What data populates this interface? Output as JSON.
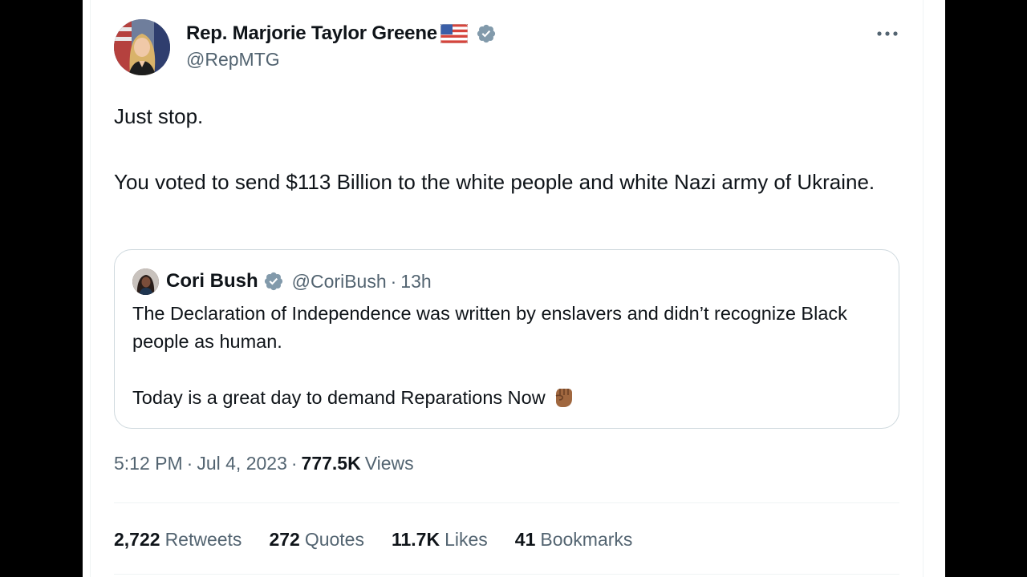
{
  "tweet": {
    "author": {
      "display_name": "Rep. Marjorie Taylor Greene",
      "handle": "@RepMTG",
      "flag_icon": "us-flag-emoji",
      "verified_icon": "verified-badge-icon",
      "verified_color": "#829aab"
    },
    "more_icon": "more-options-icon",
    "text": {
      "line1": "Just stop.",
      "line2": "You voted to send $113 Billion to the white people and white Nazi army of Ukraine."
    },
    "quote": {
      "display_name": "Cori Bush",
      "handle": "@CoriBush",
      "separator": "·",
      "time": "13h",
      "verified_icon": "verified-badge-icon",
      "text": {
        "line1": "The Declaration of Independence was written by enslavers and didn’t recognize Black people as human.",
        "line2": "Today is a great day to demand Reparations Now",
        "emoji": "raised-fist-emoji"
      }
    },
    "meta": {
      "time": "5:12 PM",
      "sep1": "·",
      "date": "Jul 4, 2023",
      "sep2": "·",
      "views_count": "777.5K",
      "views_label": "Views"
    },
    "stats": {
      "retweets": {
        "count": "2,722",
        "label": "Retweets"
      },
      "quotes": {
        "count": "272",
        "label": "Quotes"
      },
      "likes": {
        "count": "11.7K",
        "label": "Likes"
      },
      "bookmarks": {
        "count": "41",
        "label": "Bookmarks"
      }
    },
    "colors": {
      "text_primary": "#0f1419",
      "text_secondary": "#536471",
      "border": "#cfd9de",
      "divider": "#eff3f4"
    }
  }
}
